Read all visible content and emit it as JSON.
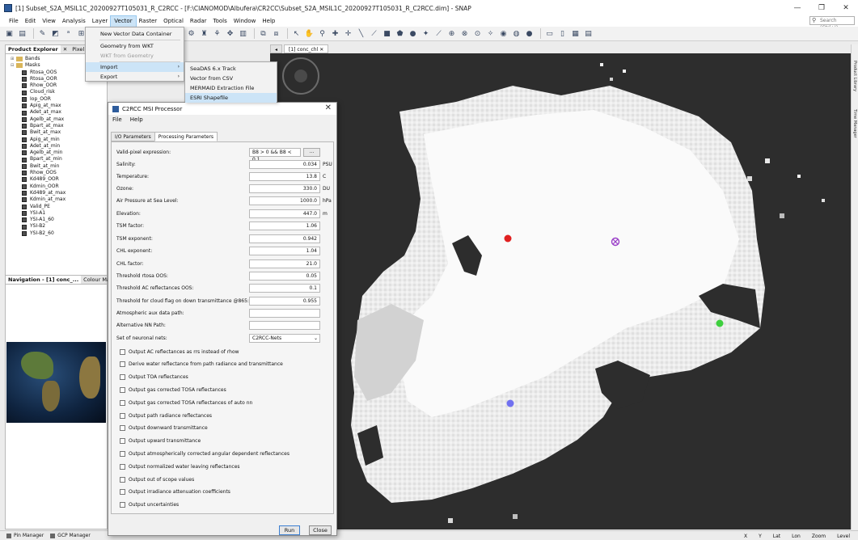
{
  "window": {
    "title": "[1] Subset_S2A_MSIL1C_20200927T105031_R_C2RCC - [F:\\CIANOMOD\\Albufera\\CR2CC\\Subset_S2A_MSIL1C_20200927T105031_R_C2RCC.dim] - SNAP",
    "min": "—",
    "restore": "❐",
    "close": "✕"
  },
  "menubar": [
    "File",
    "Edit",
    "View",
    "Analysis",
    "Layer",
    "Vector",
    "Raster",
    "Optical",
    "Radar",
    "Tools",
    "Window",
    "Help"
  ],
  "search": {
    "placeholder": "Search (Ctrl+I)"
  },
  "vector_menu": {
    "items": [
      "New Vector Data Container",
      "Geometry from WKT",
      "WKT from Geometry",
      "Import",
      "Export"
    ]
  },
  "import_menu": {
    "items": [
      "SeaDAS 6.x Track",
      "Vector from CSV",
      "MERMAID Extraction File",
      "ESRI Shapefile"
    ]
  },
  "product_explorer": {
    "tabs": [
      "Product Explorer",
      "Pixel Info"
    ],
    "folders": [
      "Bands",
      "Masks"
    ],
    "masks": [
      "Rtosa_OOS",
      "Rtosa_OOR",
      "Rhow_OOR",
      "Cloud_risk",
      "Iop_OOR",
      "Apig_at_max",
      "Adet_at_max",
      "Agelb_at_max",
      "Bpart_at_max",
      "Bwit_at_max",
      "Apig_at_min",
      "Adet_at_min",
      "Agelb_at_min",
      "Bpart_at_min",
      "Bwit_at_min",
      "Rhow_OOS",
      "Kd489_OOR",
      "Kdmin_OOR",
      "Kd489_at_max",
      "Kdmin_at_max",
      "Valid_PE",
      "YSI-A1",
      "YSI-A1_60",
      "YSI-B2",
      "YSI-B2_60"
    ]
  },
  "navigation": {
    "tabs": [
      "Navigation - [1] conc_...",
      "Colour Manipul"
    ]
  },
  "bottom": {
    "pin_manager": "Pin Manager",
    "gcp_manager": "GCP Manager"
  },
  "status": {
    "x": "X",
    "y": "Y",
    "lat": "Lat",
    "lon": "Lon",
    "zoom": "Zoom",
    "level": "Level"
  },
  "view_tabs": [
    "[1] conc_chl"
  ],
  "right_side": [
    "Product Library",
    "Time Manager"
  ],
  "dialog": {
    "title": "C2RCC MSI Processor",
    "menu": [
      "File",
      "Help"
    ],
    "tabs": [
      "I/O Parameters",
      "Processing Parameters"
    ],
    "params": [
      {
        "label": "Valid-pixel expression:",
        "value": "B8 > 0 && B8 < 0.1",
        "unit": ""
      },
      {
        "label": "Salinity:",
        "value": "0.034",
        "unit": "PSU"
      },
      {
        "label": "Temperature:",
        "value": "13.8",
        "unit": "C"
      },
      {
        "label": "Ozone:",
        "value": "330.0",
        "unit": "DU"
      },
      {
        "label": "Air Pressure at Sea Level:",
        "value": "1000.0",
        "unit": "hPa"
      },
      {
        "label": "Elevation:",
        "value": "447.0",
        "unit": "m"
      },
      {
        "label": "TSM factor:",
        "value": "1.06",
        "unit": ""
      },
      {
        "label": "TSM exponent:",
        "value": "0.942",
        "unit": ""
      },
      {
        "label": "CHL exponent:",
        "value": "1.04",
        "unit": ""
      },
      {
        "label": "CHL factor:",
        "value": "21.0",
        "unit": ""
      },
      {
        "label": "Threshold rtosa OOS:",
        "value": "0.05",
        "unit": ""
      },
      {
        "label": "Threshold AC reflectances OOS:",
        "value": "0.1",
        "unit": ""
      },
      {
        "label": "Threshold for cloud flag on down transmittance @865:",
        "value": "0.955",
        "unit": ""
      },
      {
        "label": "Atmospheric aux data path:",
        "value": "",
        "unit": ""
      },
      {
        "label": "Alternative NN Path:",
        "value": "",
        "unit": ""
      },
      {
        "label": "Set of neuronal nets:",
        "value": "C2RCC-Nets",
        "unit": ""
      }
    ],
    "browse_label": "...",
    "checkboxes": [
      "Output AC reflectances as rrs instead of rhow",
      "Derive water reflectance from path radiance and transmittance",
      "Output TOA reflectances",
      "Output gas corrected TOSA reflectances",
      "Output gas corrected TOSA reflectances of auto nn",
      "Output path radiance reflectances",
      "Output downward transmittance",
      "Output upward transmittance",
      "Output atmospherically corrected angular dependent reflectances",
      "Output normalized water leaving reflectances",
      "Output out of scope values",
      "Output irradiance attenuation coefficients",
      "Output uncertainties"
    ],
    "run": "Run",
    "close": "Close"
  },
  "pins": [
    {
      "color": "#e02020"
    },
    {
      "color": "#9a3fc8"
    },
    {
      "color": "#3ecf3e"
    },
    {
      "color": "#7070f0"
    }
  ]
}
